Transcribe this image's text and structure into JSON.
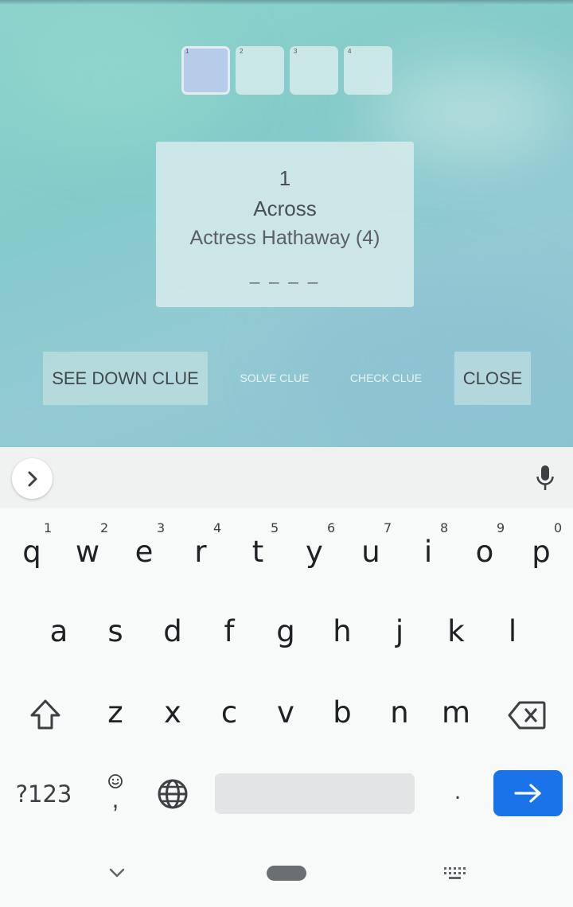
{
  "crossword": {
    "cells": [
      {
        "num": "1",
        "active": true
      },
      {
        "num": "2",
        "active": false
      },
      {
        "num": "3",
        "active": false
      },
      {
        "num": "4",
        "active": false
      }
    ],
    "clue": {
      "number": "1",
      "direction": "Across",
      "text": "Actress Hathaway (4)",
      "answer_pattern": "_ _ _ _"
    },
    "actions": {
      "see_down": "SEE DOWN CLUE",
      "solve": "SOLVE CLUE",
      "check": "CHECK CLUE",
      "close": "CLOSE"
    }
  },
  "keyboard": {
    "row1": [
      {
        "letter": "q",
        "hint": "1"
      },
      {
        "letter": "w",
        "hint": "2"
      },
      {
        "letter": "e",
        "hint": "3"
      },
      {
        "letter": "r",
        "hint": "4"
      },
      {
        "letter": "t",
        "hint": "5"
      },
      {
        "letter": "y",
        "hint": "6"
      },
      {
        "letter": "u",
        "hint": "7"
      },
      {
        "letter": "i",
        "hint": "8"
      },
      {
        "letter": "o",
        "hint": "9"
      },
      {
        "letter": "p",
        "hint": "0"
      }
    ],
    "row2": [
      "a",
      "s",
      "d",
      "f",
      "g",
      "h",
      "j",
      "k",
      "l"
    ],
    "row3": [
      "z",
      "x",
      "c",
      "v",
      "b",
      "n",
      "m"
    ],
    "symbols_key": "?123",
    "comma_key": ",",
    "period_key": ".",
    "icons": {
      "expand": "chevron-right-icon",
      "mic": "microphone-icon",
      "shift": "shift-icon",
      "backspace": "backspace-icon",
      "emoji": "emoji-icon",
      "globe": "globe-icon",
      "enter": "arrow-right-icon"
    },
    "colors": {
      "enter_key": "#1a73e8"
    }
  },
  "nav_bar": {
    "icons": [
      "chevron-down-icon",
      "home-pill",
      "keyboard-icon"
    ]
  }
}
